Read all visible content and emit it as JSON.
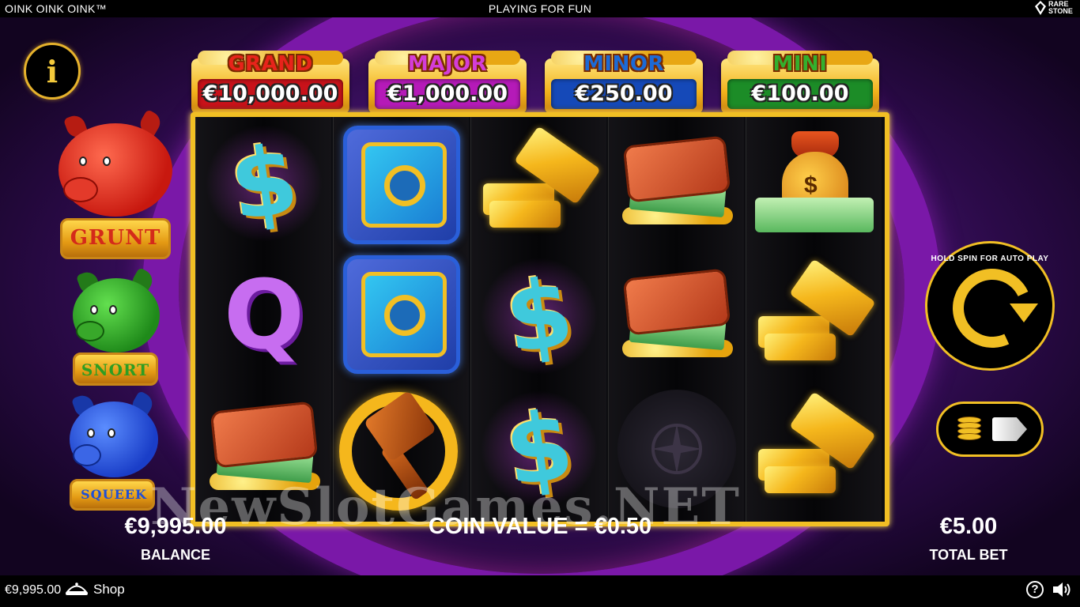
{
  "top_bar": {
    "game_title": "OINK OINK OINK™",
    "mode": "PLAYING FOR FUN",
    "brand": "RARE STONE"
  },
  "info_button": {
    "label": "i"
  },
  "pigs": [
    {
      "label": "GRUNT",
      "color": "#d42a1a"
    },
    {
      "label": "SNORT",
      "color": "#2e9d22"
    },
    {
      "label": "SQUEEK",
      "color": "#1f4fd6"
    }
  ],
  "jackpots": [
    {
      "title": "GRAND",
      "value": "€10,000.00",
      "title_color": "#e8231b",
      "plate_color": "#c8121a"
    },
    {
      "title": "MAJOR",
      "value": "€1,000.00",
      "title_color": "#d43dd8",
      "plate_color": "#b51ab8"
    },
    {
      "title": "MINOR",
      "value": "€250.00",
      "title_color": "#1c6ad6",
      "plate_color": "#1549b8"
    },
    {
      "title": "MINI",
      "value": "€100.00",
      "title_color": "#33b02e",
      "plate_color": "#1c8c27"
    }
  ],
  "reels": [
    [
      "dollar",
      "Q",
      "wallet"
    ],
    [
      "safe",
      "safe",
      "hammer"
    ],
    [
      "gold",
      "dollar",
      "dollar"
    ],
    [
      "wallet",
      "wallet",
      "blank"
    ],
    [
      "bag",
      "gold",
      "gold"
    ]
  ],
  "symbols": {
    "Q": "Q",
    "dollar": "$",
    "bag": "$"
  },
  "spin_button": {
    "label": "HOLD SPIN FOR AUTO PLAY"
  },
  "bet_button": {
    "icon": "coin-stack-arrow"
  },
  "balance": {
    "value": "€9,995.00",
    "label": "BALANCE"
  },
  "coin_value": "COIN VALUE = €0.50",
  "total_bet": {
    "value": "€5.00",
    "label": "TOTAL BET"
  },
  "watermark": "NewSlotGames.NET",
  "footer": {
    "balance": "€9,995.00",
    "shop_label": "Shop",
    "help": "?"
  },
  "colors": {
    "accent_gold": "#f1bf24",
    "background": "#4a1476"
  }
}
